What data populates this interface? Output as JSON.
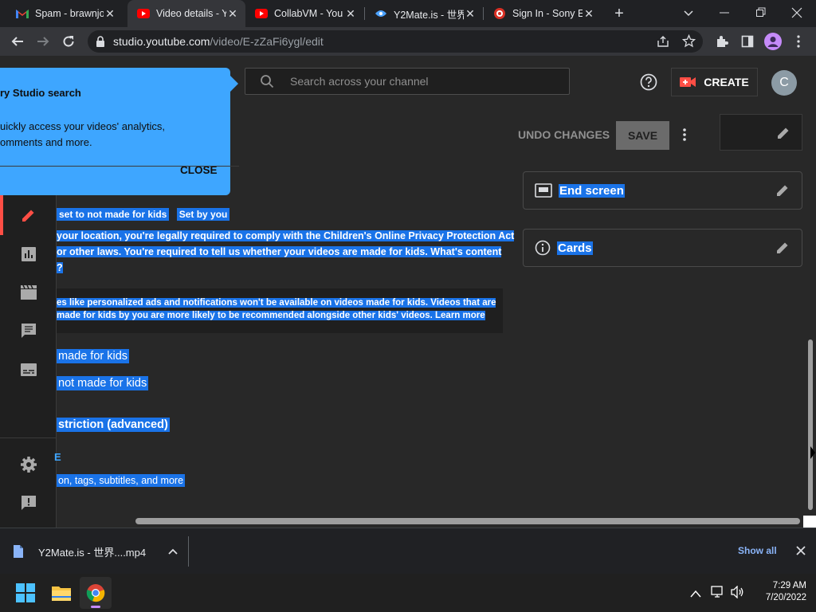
{
  "browser": {
    "tabs": [
      {
        "title": "Spam - brawnjo",
        "icon": "gmail-icon"
      },
      {
        "title": "Video details - Y",
        "icon": "youtube-icon",
        "active": true
      },
      {
        "title": "CollabVM - You",
        "icon": "youtube-icon"
      },
      {
        "title": "Y2Mate.is - 世界",
        "icon": "y2mate-icon"
      },
      {
        "title": "Sign In - Sony E",
        "icon": "sony-icon"
      }
    ],
    "url_host": "studio.youtube.com",
    "url_path": "/video/E-zZaFi6ygl/edit"
  },
  "studio": {
    "search_placeholder": "Search across your channel",
    "create_label": "CREATE",
    "avatar_letter": "C",
    "undo_label": "UNDO CHANGES",
    "save_label": "SAVE",
    "tooltip": {
      "title": "ry Studio search",
      "line1": "uickly access your videos' analytics,",
      "line2": "omments and more.",
      "close": "CLOSE"
    },
    "audience": {
      "status": "set to not made for kids",
      "badge": "Set by you",
      "para1_line1": "your location, you're legally required to comply with the Children's Online Privacy Protection Act",
      "para1_line2": "or other laws. You're required to tell us whether your videos are made for kids. What's content",
      "para1_line3": "?",
      "notice_line1": "es like personalized ads and notifications won't be available on videos made for kids. Videos that are",
      "notice_line2": "made for kids by you are more likely to be recommended alongside other kids' videos. Learn more",
      "opt_made": "made for kids",
      "opt_not_made": "not made for kids",
      "age_restriction": "striction (advanced)",
      "show_more": "E",
      "show_more_sub": "on, tags, subtitles, and more"
    },
    "right_cards": [
      {
        "label": "End screen",
        "icon": "end-screen-icon"
      },
      {
        "label": "Cards",
        "icon": "info-icon"
      }
    ],
    "accent": "#1a73e8"
  },
  "downloads": {
    "file": "Y2Mate.is - 世界....mp4",
    "show_all": "Show all"
  },
  "taskbar": {
    "time": "7:29 AM",
    "date": "7/20/2022"
  }
}
